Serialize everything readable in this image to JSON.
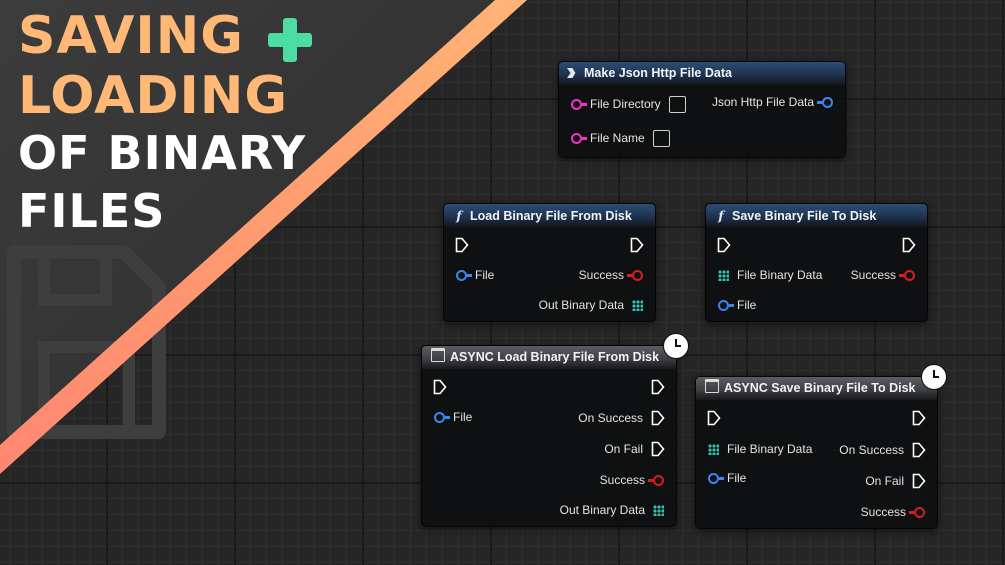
{
  "thumbnail": {
    "title_line_1": "SAVING",
    "title_line_2": "LOADING",
    "title_line_3": "OF BINARY",
    "title_line_4": "FILES",
    "plus_color": "#4ddca4",
    "title_orange": "#ffb876",
    "stripe_colors": [
      "#ffc07a",
      "#ff8272"
    ]
  },
  "nodes": {
    "make_json": {
      "title": "Make Json Http File Data",
      "icon": "struct-make-icon",
      "in_pins": [
        "File Directory",
        "File Name"
      ],
      "out_pin": "Json Http File Data"
    },
    "load_binary": {
      "title": "Load Binary File From Disk",
      "icon": "function-icon",
      "in_pin": "File",
      "out_success": "Success",
      "out_data": "Out Binary Data"
    },
    "save_binary": {
      "title": "Save Binary File To Disk",
      "icon": "function-icon",
      "in_data": "File Binary Data",
      "in_file": "File",
      "out_success": "Success"
    },
    "async_load": {
      "title": "ASYNC Load Binary File From Disk",
      "icon": "async-macro-icon",
      "in_pin": "File",
      "out_on_success": "On Success",
      "out_on_fail": "On Fail",
      "out_success": "Success",
      "out_data": "Out Binary Data"
    },
    "async_save": {
      "title": "ASYNC Save Binary File To Disk",
      "icon": "async-macro-icon",
      "in_data": "File Binary Data",
      "in_file": "File",
      "out_on_success": "On Success",
      "out_on_fail": "On Fail",
      "out_success": "Success"
    }
  },
  "pin_colors": {
    "object": "#3b86f0",
    "string": "#f232c8",
    "boolean": "#d81e1e",
    "byte_array": "#29c6b8",
    "exec": "#ffffff"
  }
}
